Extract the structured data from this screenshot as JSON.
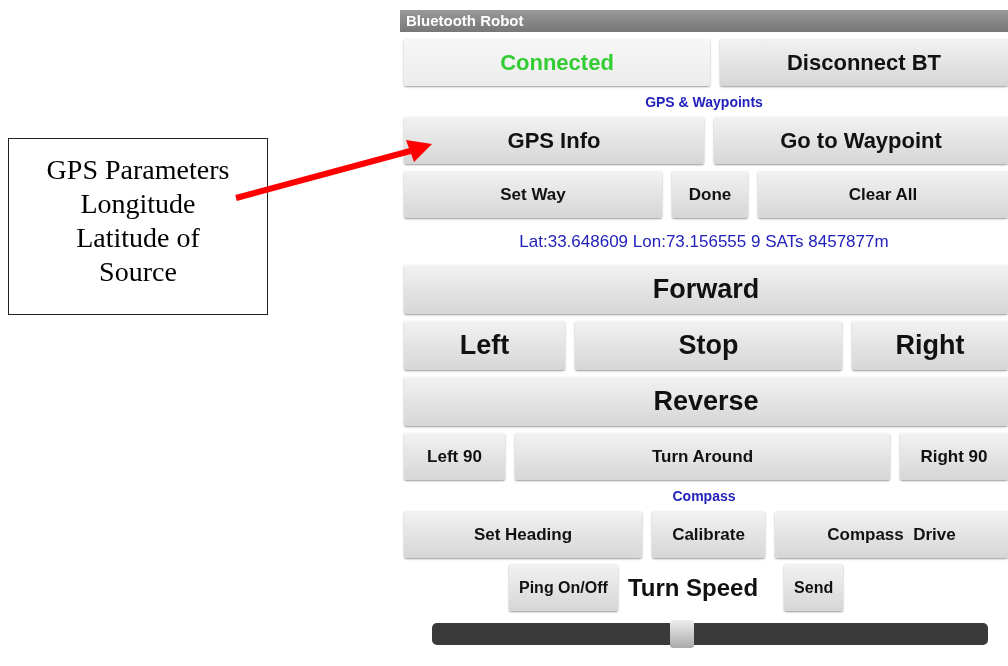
{
  "callout": {
    "lines": [
      "GPS Parameters",
      "Longitude",
      "Latitude of",
      "Source"
    ]
  },
  "app": {
    "title": "Bluetooth Robot",
    "rows": [
      {
        "kind": "buttons",
        "buttons": [
          {
            "label": "Connected",
            "kind": "status"
          },
          {
            "label": "Disconnect BT",
            "kind": "action"
          }
        ]
      },
      {
        "kind": "heading",
        "text": "GPS & Waypoints"
      },
      {
        "kind": "buttons",
        "buttons": [
          {
            "label": "GPS Info",
            "kind": "action"
          },
          {
            "label": "Go to Waypoint",
            "kind": "action"
          }
        ]
      },
      {
        "kind": "buttons",
        "buttons": [
          {
            "label": "Set Way",
            "kind": "action"
          },
          {
            "label": "Done",
            "kind": "action"
          },
          {
            "label": "Clear All",
            "kind": "action"
          }
        ]
      },
      {
        "kind": "info",
        "text": "Lat:33.648609 Lon:73.156555 9 SATs 8457877m"
      },
      {
        "kind": "drive",
        "buttons": [
          {
            "label": "Forward",
            "kind": "action"
          }
        ]
      },
      {
        "kind": "drive",
        "buttons": [
          {
            "label": "Left",
            "kind": "action"
          },
          {
            "label": "Stop",
            "kind": "action"
          },
          {
            "label": "Right",
            "kind": "action"
          }
        ]
      },
      {
        "kind": "drive",
        "buttons": [
          {
            "label": "Reverse",
            "kind": "action"
          }
        ]
      },
      {
        "kind": "buttons",
        "buttons": [
          {
            "label": "Left 90",
            "kind": "action"
          },
          {
            "label": "Turn Around",
            "kind": "action"
          },
          {
            "label": "Right 90",
            "kind": "action"
          }
        ]
      },
      {
        "kind": "heading",
        "text": "Compass"
      },
      {
        "kind": "buttons",
        "buttons": [
          {
            "label": "Set Heading",
            "kind": "action"
          },
          {
            "label": "Calibrate",
            "kind": "action"
          },
          {
            "label": "Compass  Drive",
            "kind": "action"
          }
        ]
      },
      {
        "kind": "speed",
        "ping": "Ping On/Off",
        "label": "Turn Speed",
        "send": "Send"
      },
      {
        "kind": "slider",
        "level": 0.45
      }
    ]
  }
}
